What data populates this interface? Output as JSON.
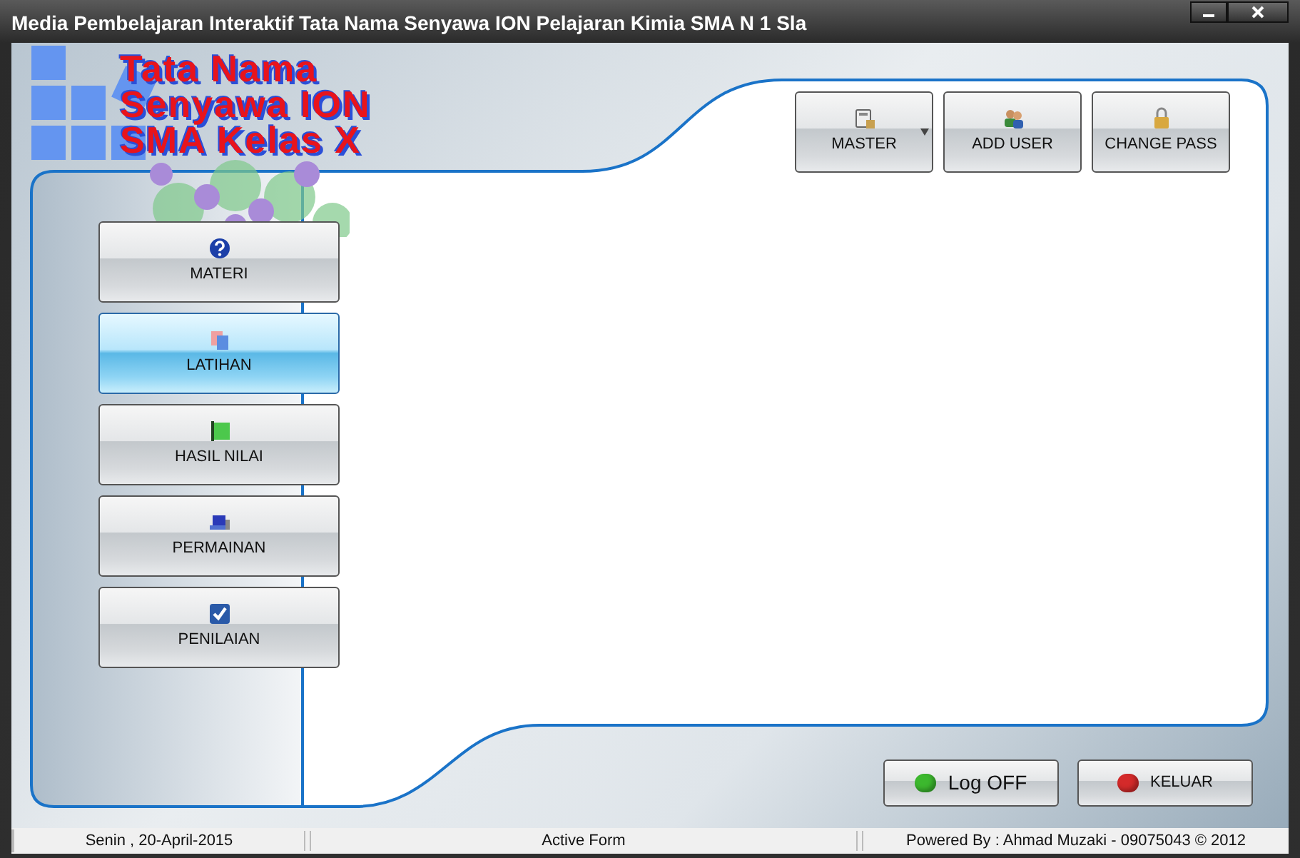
{
  "window": {
    "title": "Media Pembelajaran Interaktif Tata Nama Senyawa ION Pelajaran Kimia SMA N 1 Sla"
  },
  "logo": {
    "lines": [
      "Tata Nama",
      "Senyawa ION",
      "SMA Kelas X"
    ]
  },
  "toolbar": [
    {
      "label": "MASTER",
      "kind": "database",
      "dropdown": true
    },
    {
      "label": "ADD USER",
      "kind": "users",
      "dropdown": false
    },
    {
      "label": "CHANGE PASS",
      "kind": "lock",
      "dropdown": false
    }
  ],
  "menu": [
    {
      "label": "MATERI",
      "kind": "help",
      "selected": false
    },
    {
      "label": "LATIHAN",
      "kind": "copy",
      "selected": true
    },
    {
      "label": "HASIL NILAI",
      "kind": "flag",
      "selected": false
    },
    {
      "label": "PERMAINAN",
      "kind": "computer",
      "selected": false
    },
    {
      "label": "PENILAIAN",
      "kind": "check",
      "selected": false
    }
  ],
  "footer_buttons": [
    {
      "label": "Log OFF",
      "color": "#3cb82e"
    },
    {
      "label": "KELUAR",
      "color": "#d42a2a"
    }
  ],
  "status_bar": {
    "date": "Senin , 20-April-2015",
    "form": "Active Form",
    "credit": "Powered By : Ahmad Muzaki - 09075043 © 2012"
  }
}
